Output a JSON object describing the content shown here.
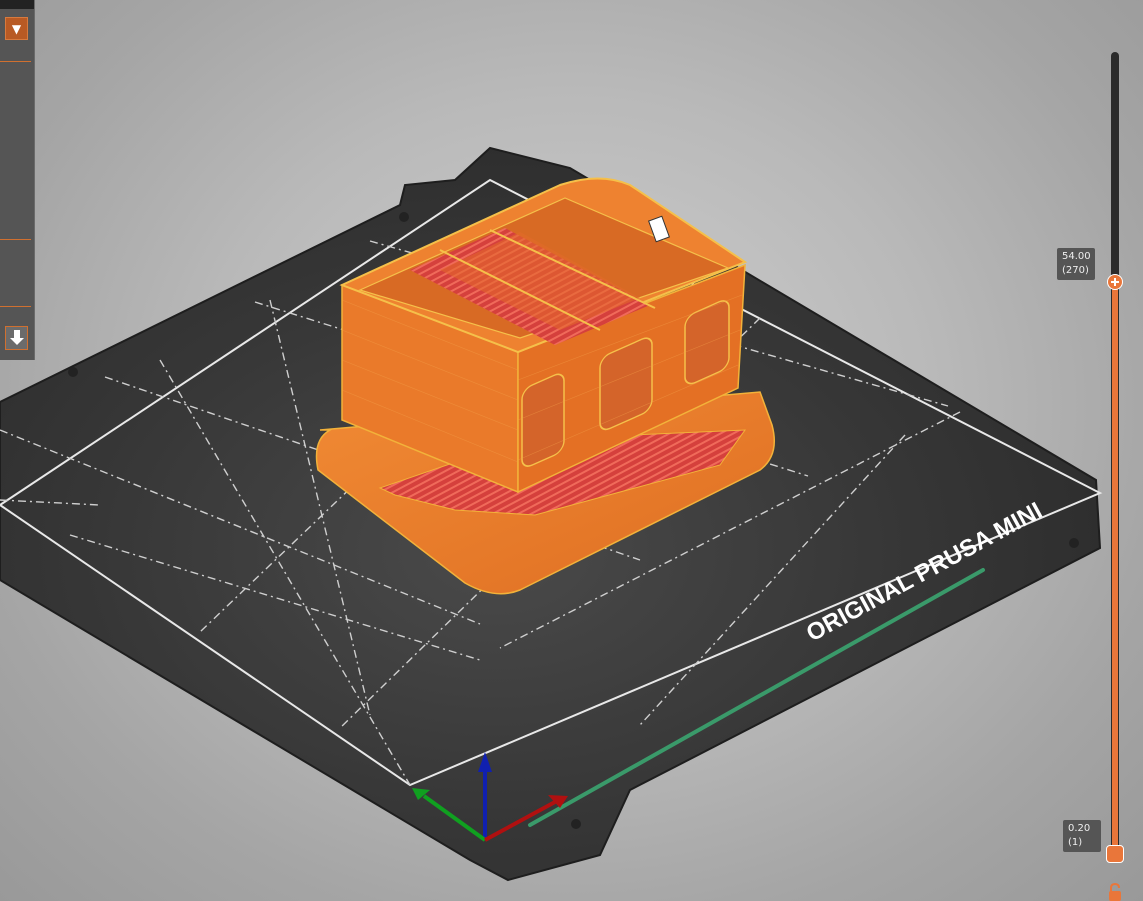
{
  "app": "PrusaSlicer preview",
  "bed": {
    "label": "ORIGINAL PRUSA MINI"
  },
  "layer_slider": {
    "top": {
      "height": "54.00",
      "layer": "(270)"
    },
    "bottom": {
      "height": "0.20",
      "layer": "(1)"
    }
  },
  "colors": {
    "model": "#e9782a",
    "model_edge": "#f2b23a",
    "infill": "#d2403e",
    "bed": "#2e2e2e",
    "accent": "#e9763a"
  },
  "icons": {
    "panel_dropdown": "chevron-down-icon",
    "export": "export-icon",
    "lock": "lock-icon"
  }
}
